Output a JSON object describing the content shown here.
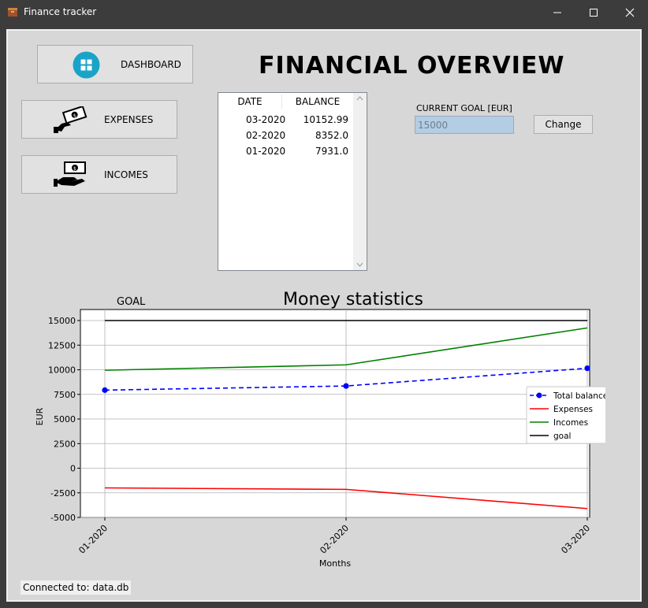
{
  "window": {
    "title": "Finance tracker"
  },
  "nav": {
    "dashboard": "DASHBOARD",
    "expenses": "EXPENSES",
    "incomes": "INCOMES"
  },
  "heading": "FINANCIAL OVERVIEW",
  "table": {
    "columns": [
      "DATE",
      "BALANCE"
    ],
    "rows": [
      [
        "03-2020",
        "10152.99"
      ],
      [
        "02-2020",
        "8352.0"
      ],
      [
        "01-2020",
        "7931.0"
      ]
    ]
  },
  "goal": {
    "label": "CURRENT GOAL [EUR]",
    "value": "15000",
    "change_label": "Change"
  },
  "status": "Connected to: data.db",
  "colors": {
    "balance": "#0000ff",
    "expenses": "#ff0000",
    "incomes": "#008000",
    "goal": "#000000",
    "accent": "#1aa3c8"
  },
  "chart_data": {
    "type": "line",
    "title": "Money statistics",
    "annotation": "GOAL",
    "xlabel": "Months",
    "ylabel": "EUR",
    "categories": [
      "01-2020",
      "02-2020",
      "03-2020"
    ],
    "ylim": [
      -5000,
      16000
    ],
    "yticks": [
      15000,
      12500,
      10000,
      7500,
      5000,
      2500,
      0,
      -2500,
      -5000
    ],
    "grid": true,
    "legend_position": "center-right",
    "series": [
      {
        "name": "Total balance",
        "values": [
          7931.0,
          8352.0,
          10152.99
        ],
        "style": "dashed-marker",
        "color": "#0000ff"
      },
      {
        "name": "Expenses",
        "values": [
          -2000,
          -2150,
          -4100
        ],
        "style": "solid",
        "color": "#ff0000"
      },
      {
        "name": "Incomes",
        "values": [
          9950,
          10500,
          14250
        ],
        "style": "solid",
        "color": "#008000"
      },
      {
        "name": "goal",
        "values": [
          15000,
          15000,
          15000
        ],
        "style": "solid",
        "color": "#000000"
      }
    ]
  }
}
